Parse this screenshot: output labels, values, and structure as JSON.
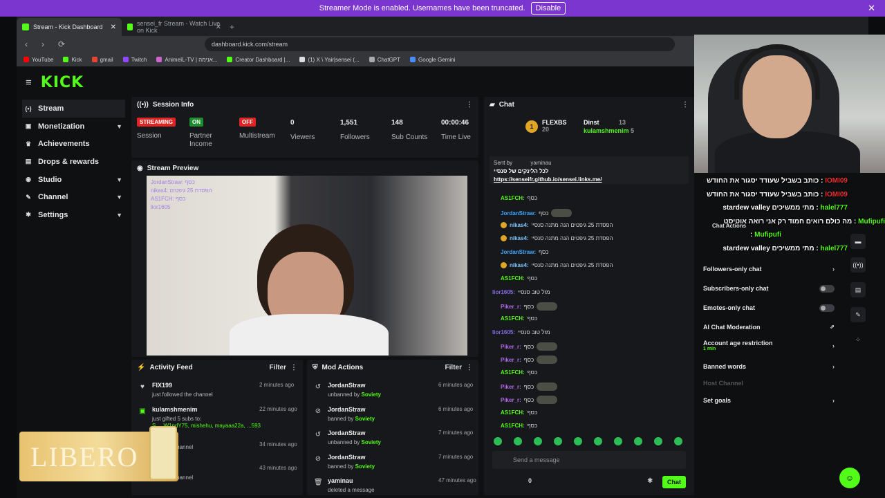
{
  "banner": {
    "text": "Streamer Mode is enabled. Usernames have been truncated.",
    "button": "Disable"
  },
  "tabs": [
    {
      "label": "Stream - Kick Dashboard",
      "active": true
    },
    {
      "label": "sensei_fr Stream - Watch Live on Kick",
      "active": false
    }
  ],
  "address": {
    "url": "dashboard.kick.com/stream"
  },
  "bookmarks": [
    "YouTube",
    "Kick",
    "gmail",
    "Twitch",
    "AnimeIL-TV | אנימה...",
    "Creator Dashboard |...",
    "(1) X \\ Yair|sensei (...",
    "ChatGPT",
    "Google Gemini"
  ],
  "brand": {
    "logo": "KICK",
    "accent": "#53fc18",
    "banner_color": "#7b36cf"
  },
  "sidebar": [
    {
      "label": "Stream",
      "icon": "stream-icon",
      "chev": false
    },
    {
      "label": "Monetization",
      "icon": "monetization-icon",
      "chev": true
    },
    {
      "label": "Achievements",
      "icon": "trophy-icon",
      "chev": false
    },
    {
      "label": "Drops & rewards",
      "icon": "gift-icon",
      "chev": false
    },
    {
      "label": "Studio",
      "icon": "studio-icon",
      "chev": true
    },
    {
      "label": "Channel",
      "icon": "channel-icon",
      "chev": true
    },
    {
      "label": "Settings",
      "icon": "gear-icon",
      "chev": true
    }
  ],
  "session": {
    "title": "Session Info",
    "streaming": "STREAMING",
    "session_lbl": "Session",
    "on": "ON",
    "partner_lbl": "Partner Income",
    "off": "OFF",
    "multistream_lbl": "Multistream",
    "viewers": "0",
    "viewers_lbl": "Viewers",
    "followers": "1,551",
    "followers_lbl": "Followers",
    "subs": "148",
    "subs_lbl": "Sub Counts",
    "time": "00:00:46",
    "time_lbl": "Time Live"
  },
  "preview": {
    "title": "Stream Preview",
    "overlay": [
      "JordanStraw: כסף",
      "nikas4: הפסדת 25 גיפטים",
      "AS1FCH: כסף",
      "lior1605"
    ]
  },
  "activity": {
    "title": "Activity Feed",
    "filter": "Filter",
    "items": [
      {
        "name": "FIX199",
        "desc": "just followed the channel",
        "time": "2 minutes ago"
      },
      {
        "name": "kulamshmenim",
        "desc": "just gifted 5 subs to:",
        "gift": "S..., W1ndY75, mishehu, mayaaa22a, ...593",
        "time": "22 minutes ago"
      },
      {
        "name": "",
        "desc": "...ed the channel",
        "time": "34 minutes ago"
      },
      {
        "name": "...mon",
        "desc": "...ed the channel",
        "time": "43 minutes ago"
      }
    ]
  },
  "mod": {
    "title": "Mod Actions",
    "filter": "Filter",
    "items": [
      {
        "name": "JordanStraw",
        "act": "unbanned by",
        "by": "Soviety",
        "time": "6 minutes ago"
      },
      {
        "name": "JordanStraw",
        "act": "banned by",
        "by": "Soviety",
        "time": "6 minutes ago"
      },
      {
        "name": "JordanStraw",
        "act": "unbanned by",
        "by": "Soviety",
        "time": "7 minutes ago"
      },
      {
        "name": "JordanStraw",
        "act": "banned by",
        "by": "Soviety",
        "time": "7 minutes ago"
      },
      {
        "name": "yaminau",
        "act": "deleted a message",
        "by": "",
        "time": "47 minutes ago"
      }
    ]
  },
  "chat": {
    "title": "Chat",
    "top": [
      {
        "name": "FLEXBS",
        "count": "20"
      },
      {
        "name": "Dinst",
        "count": "13"
      },
      {
        "name": "kulamshmenim",
        "count": "5"
      }
    ],
    "pinned_by_label": "Sent by",
    "pinned_by": "yaminau",
    "pinned_text": "לכל הלינקים של סנסיי",
    "pinned_link": "https://senseifr.github.io/sensei.links.me/",
    "messages": [
      {
        "user": "AS1FCH:",
        "text": "כסף",
        "color": "#53fc18"
      },
      {
        "user": "JordanStraw:",
        "text": "כסף",
        "color": "#3ea8ff"
      },
      {
        "user": "nikas4:",
        "text": "הפסדת 25 גיפטים הנה מתנה סנסיי",
        "color": "#7ec6ff"
      },
      {
        "user": "nikas4:",
        "text": "הפסדת 25 גיפטים הנה מתנה סנסיי",
        "color": "#7ec6ff"
      },
      {
        "user": "JordanStraw:",
        "text": "כסף",
        "color": "#3ea8ff"
      },
      {
        "user": "nikas4:",
        "text": "הפסדת 25 גיפטים הנה מתנה סנסיי",
        "color": "#7ec6ff"
      },
      {
        "user": "AS1FCH:",
        "text": "כסף",
        "color": "#53fc18"
      },
      {
        "user": "lior1605:",
        "text": "מזל טוב סנסיי",
        "color": "#8a6be8"
      },
      {
        "user": "Piker_r:",
        "text": "כסף",
        "color": "#b06ae8"
      },
      {
        "user": "AS1FCH:",
        "text": "כסף",
        "color": "#53fc18"
      },
      {
        "user": "lior1605:",
        "text": "מזל טוב סנסיי",
        "color": "#8a6be8"
      },
      {
        "user": "Piker_r:",
        "text": "כסף",
        "color": "#b06ae8"
      },
      {
        "user": "Piker_r:",
        "text": "כסף",
        "color": "#b06ae8"
      },
      {
        "user": "AS1FCH:",
        "text": "כסף",
        "color": "#53fc18"
      },
      {
        "user": "Piker_r:",
        "text": "כסף",
        "color": "#b06ae8"
      },
      {
        "user": "Piker_r:",
        "text": "כסף",
        "color": "#b06ae8"
      },
      {
        "user": "AS1FCH:",
        "text": "כסף",
        "color": "#53fc18"
      },
      {
        "user": "AS1FCH:",
        "text": "כסף",
        "color": "#53fc18"
      }
    ],
    "placeholder": "Send a message",
    "count": "0",
    "send": "Chat"
  },
  "overlay_chat": [
    {
      "user": "IOMI09",
      "text": "כותב בשביל שעודד יסגור את החודש",
      "color": "#e33"
    },
    {
      "user": "IOMI09",
      "text": "כותב בשביל שעודד יסגור את החודש",
      "color": "#e33"
    },
    {
      "user": "halel777",
      "text": "stardew valley מתי ממשיכים",
      "color": "#53fc18"
    },
    {
      "user": "Mufipufi",
      "text": "מה כולם רואים חמוד רק אני רואה אוטיסט",
      "color": "#53fc18"
    },
    {
      "user": "Mufipufi",
      "text": ":",
      "color": "#53fc18"
    },
    {
      "user": "halel777",
      "text": "stardew valley מתי ממשיכים",
      "color": "#53fc18"
    }
  ],
  "chat_actions": {
    "title": "Chat Actions",
    "items": [
      {
        "label": "Followers-only chat",
        "kind": "arrow"
      },
      {
        "label": "Subscribers-only chat",
        "kind": "toggle"
      },
      {
        "label": "Emotes-only chat",
        "kind": "toggle"
      },
      {
        "label": "AI Chat Moderation",
        "kind": "ext"
      },
      {
        "label": "Account age restriction",
        "kind": "arrow",
        "sub": "1 min"
      },
      {
        "label": "Banned words",
        "kind": "arrow"
      },
      {
        "label": "Host Channel",
        "kind": "none"
      },
      {
        "label": "Set goals",
        "kind": "arrow"
      }
    ]
  },
  "ad": {
    "text": "LIBERO"
  }
}
